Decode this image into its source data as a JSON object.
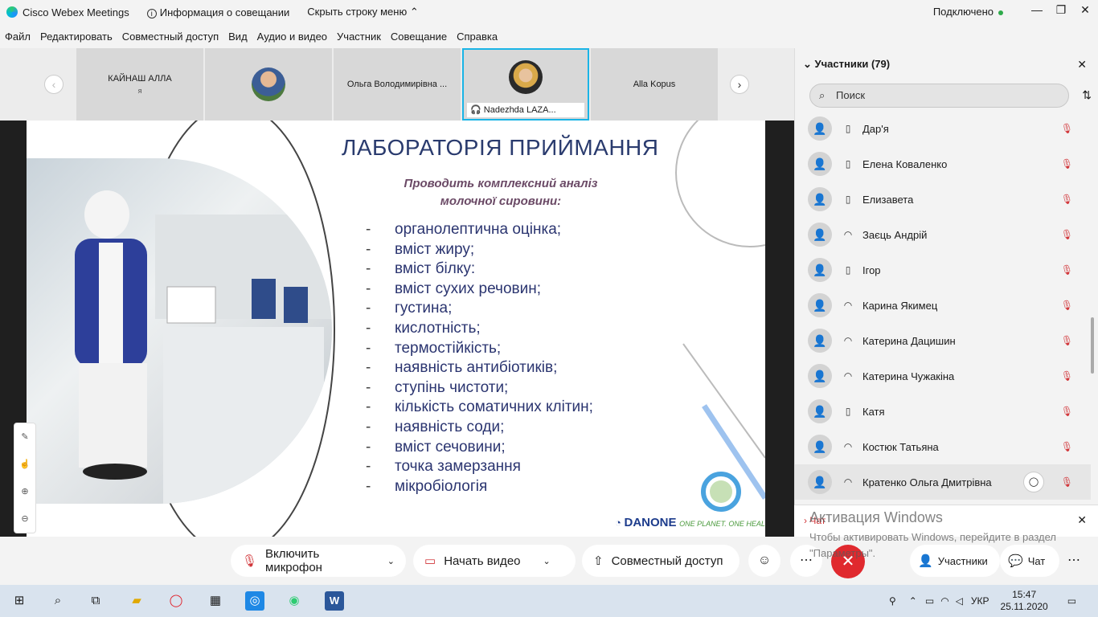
{
  "titlebar": {
    "app_name": "Cisco Webex Meetings",
    "meeting_info": "Информация о совещании",
    "hide_menu": "Скрыть строку меню",
    "status": "Подключено"
  },
  "menu": [
    "Файл",
    "Редактировать",
    "Совместный доступ",
    "Вид",
    "Аудио и видео",
    "Участник",
    "Совещание",
    "Справка"
  ],
  "video_strip": {
    "tiles": [
      {
        "name": "КАЙНАШ АЛЛА",
        "sub": "я"
      },
      {
        "name": ""
      },
      {
        "name": "Ольга Володимирівна ..."
      },
      {
        "name": "Nadezhda LAZA..."
      },
      {
        "name": "Alla Kopus"
      }
    ]
  },
  "slide": {
    "title": "ЛАБОРАТОРІЯ ПРИЙМАННЯ",
    "subtitle_line1": "Проводить комплексний аналіз",
    "subtitle_line2": "молочної сировини:",
    "bullets": [
      "органолептична оцінка;",
      "вміст жиру;",
      "вміст білку:",
      "вміст сухих речовин;",
      "густина;",
      "кислотність;",
      "термостійкість;",
      "наявність антибіотиків;",
      "ступінь чистоти;",
      "кількість соматичних клітин;",
      "наявність соди;",
      "вміст сечовини;",
      "точка замерзання",
      "мікробіологія"
    ],
    "bullet_marker": "-",
    "brand": "DANONE",
    "brand_tagline": "ONE PLANET. ONE HEALTH"
  },
  "controls": {
    "mic": "Включить микрофон",
    "video": "Начать видео",
    "share": "Совместный доступ",
    "participants": "Участники",
    "chat": "Чат"
  },
  "participants_panel": {
    "title": "Участники (79)",
    "search_placeholder": "Поиск",
    "list": [
      {
        "name": "Дар'я",
        "device": "phone"
      },
      {
        "name": "Елена Коваленко",
        "device": "phone"
      },
      {
        "name": "Елизавета",
        "device": "phone"
      },
      {
        "name": "Заєць Андрій",
        "device": "headset"
      },
      {
        "name": "Ігор",
        "device": "phone"
      },
      {
        "name": "Карина Якимец",
        "device": "headset"
      },
      {
        "name": "Катерина Дацишин",
        "device": "headset"
      },
      {
        "name": "Катерина Чужакіна",
        "device": "headset"
      },
      {
        "name": "Катя",
        "device": "phone"
      },
      {
        "name": "Костюк Татьяна",
        "device": "headset"
      },
      {
        "name": "Кратенко Ольга Дмитрівна",
        "device": "headset"
      }
    ]
  },
  "chat_panel": {
    "title": "Чат"
  },
  "watermark": {
    "line1": "Активация Windows",
    "line2": "Чтобы активировать Windows, перейдите в раздел \"Параметры\"."
  },
  "taskbar": {
    "lang": "УКР",
    "time": "15:47",
    "date": "25.11.2020"
  },
  "colors": {
    "accent": "#1ab4e6",
    "end_call": "#e0292e",
    "muted": "#d13438"
  }
}
